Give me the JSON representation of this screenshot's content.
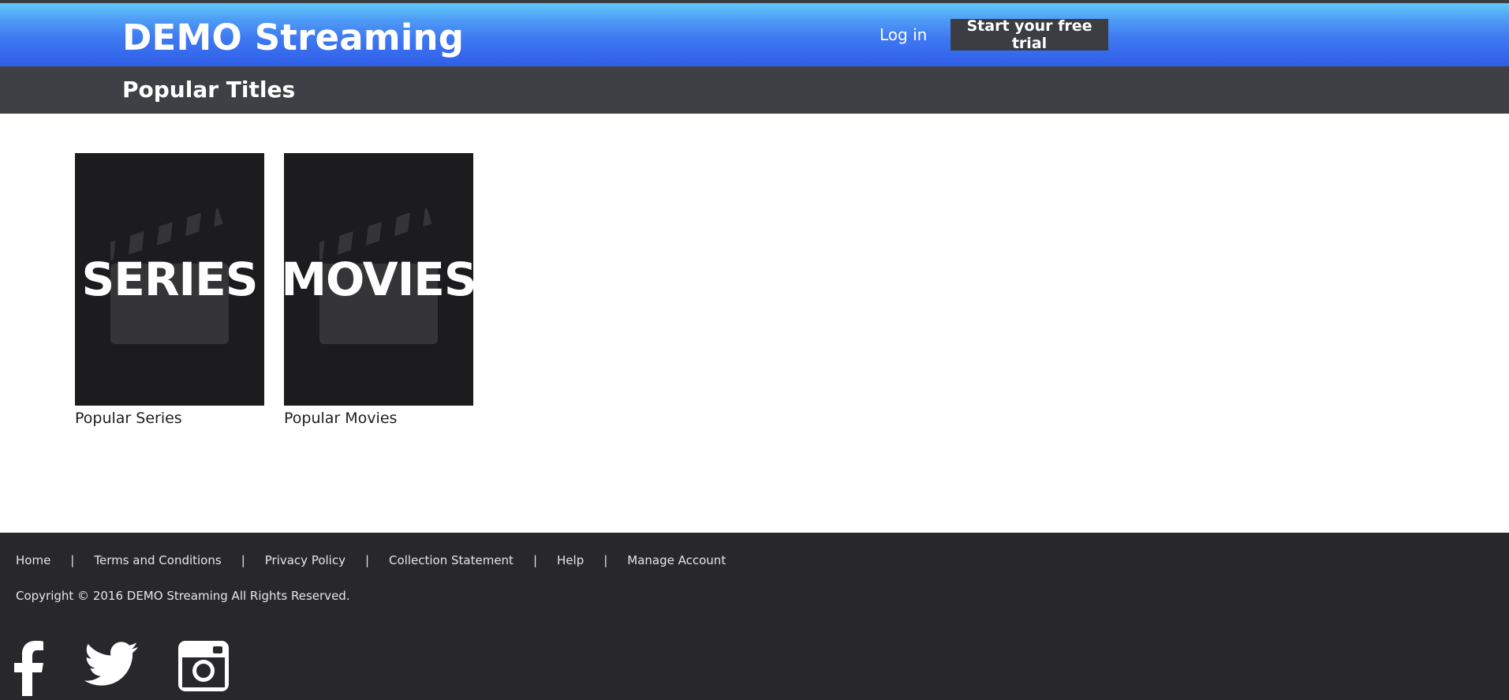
{
  "header": {
    "logo": "DEMO Streaming",
    "login_label": "Log in",
    "trial_label": "Start your free trial"
  },
  "subheader": {
    "title": "Popular Titles"
  },
  "tiles": [
    {
      "overlay": "SERIES",
      "caption": "Popular Series"
    },
    {
      "overlay": "MOVIES",
      "caption": "Popular Movies"
    }
  ],
  "footer": {
    "links": [
      "Home",
      "Terms and Conditions",
      "Privacy Policy",
      "Collection Statement",
      "Help",
      "Manage Account"
    ],
    "separator": "|",
    "copyright": "Copyright © 2016 DEMO Streaming All Rights Reserved.",
    "social_icons": [
      "facebook-icon",
      "twitter-icon",
      "instagram-icon"
    ]
  },
  "colors": {
    "header_gradient_top": "#5fc9f8",
    "header_gradient_bottom": "#2f5ee8",
    "subheader_bg": "#3f4046",
    "tile_bg": "#1c1c1f",
    "footer_bg": "#28282b",
    "trial_button_bg": "#3b3d43"
  }
}
